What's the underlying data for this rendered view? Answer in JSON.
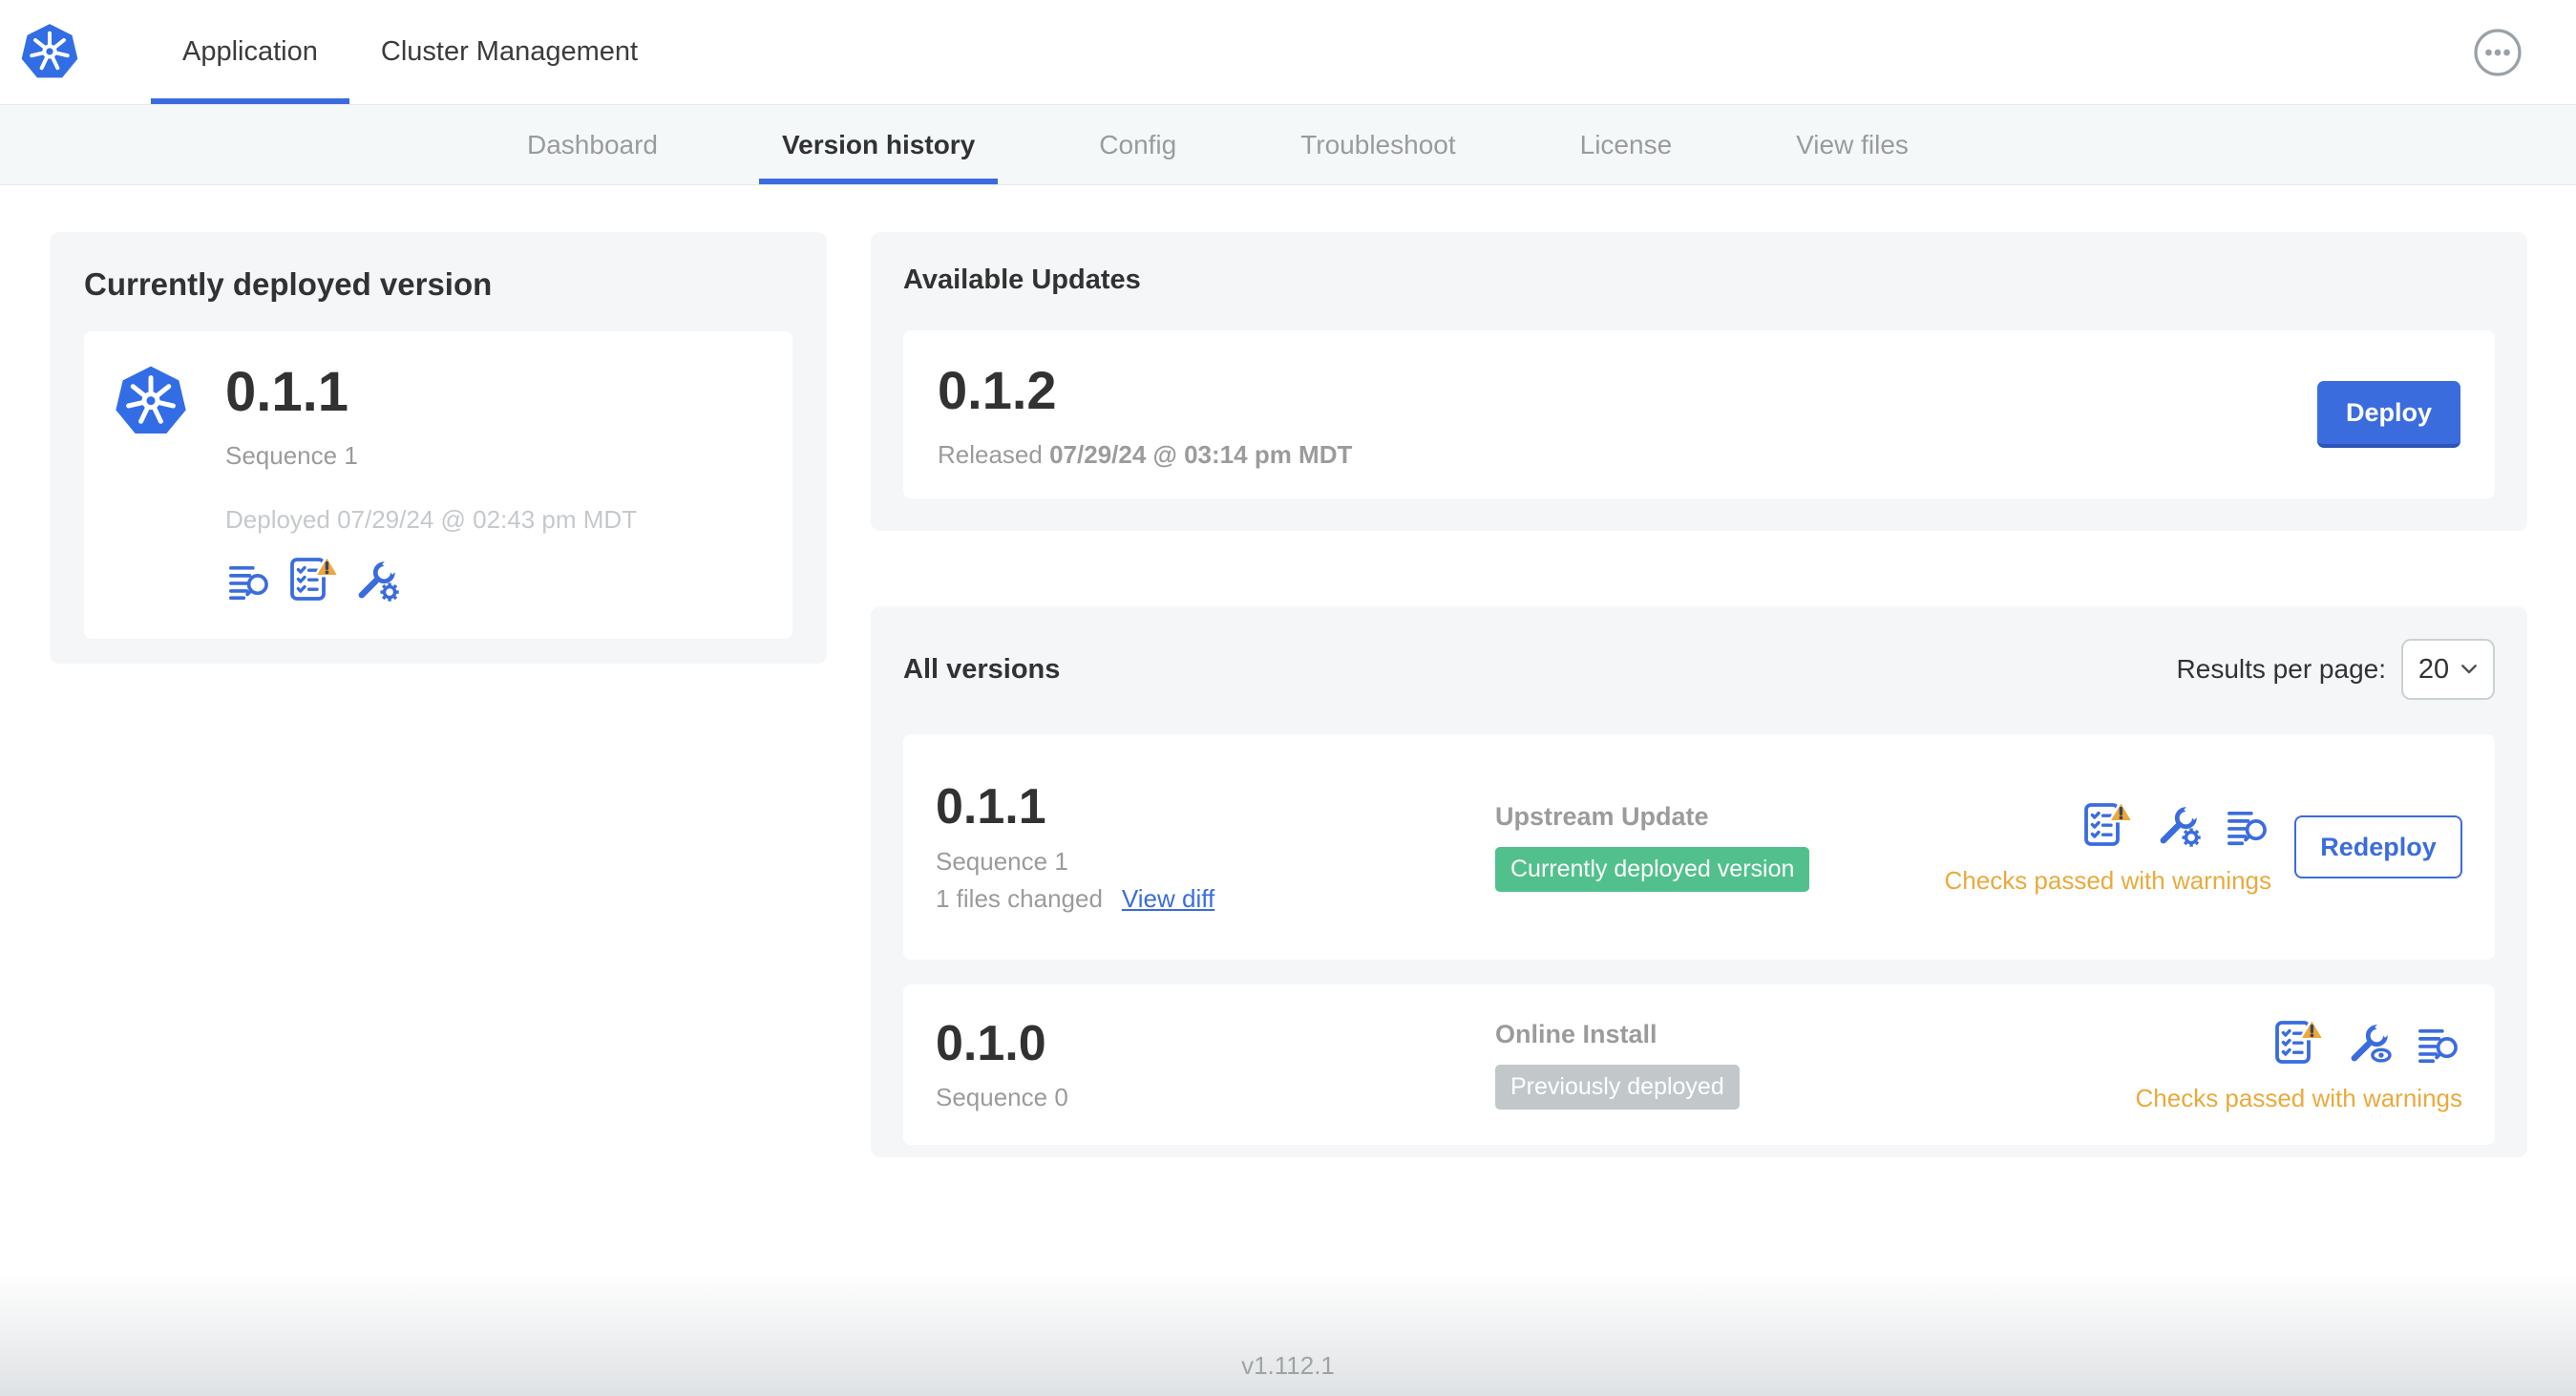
{
  "header": {
    "tabs": [
      {
        "label": "Application",
        "active": true
      },
      {
        "label": "Cluster Management",
        "active": false
      }
    ],
    "more_menu_icon": "ellipsis-in-circle"
  },
  "subnav": {
    "tabs": [
      {
        "label": "Dashboard",
        "active": false
      },
      {
        "label": "Version history",
        "active": true
      },
      {
        "label": "Config",
        "active": false
      },
      {
        "label": "Troubleshoot",
        "active": false
      },
      {
        "label": "License",
        "active": false
      },
      {
        "label": "View files",
        "active": false
      }
    ]
  },
  "current_version": {
    "title": "Currently deployed version",
    "version": "0.1.1",
    "sequence": "Sequence 1",
    "deployed": "Deployed 07/29/24 @ 02:43 pm MDT",
    "icons": [
      "release-notes-icon",
      "preflight-checks-warning-icon",
      "edit-config-icon"
    ]
  },
  "available_updates": {
    "title": "Available Updates",
    "version": "0.1.2",
    "released_prefix": "Released",
    "released_date": "07/29/24 @ 03:14 pm MDT",
    "deploy_button": "Deploy"
  },
  "all_versions": {
    "title": "All versions",
    "results_per_page_label": "Results per page:",
    "results_per_page_value": "20",
    "rows": [
      {
        "version": "0.1.1",
        "sequence": "Sequence 1",
        "files_changed": "1 files changed",
        "view_diff_link": "View diff",
        "source": "Upstream Update",
        "badge": "Currently deployed version",
        "badge_style": "green",
        "icons": [
          "preflight-checks-warning-icon",
          "edit-config-icon",
          "release-notes-icon"
        ],
        "status": "Checks passed with warnings",
        "action_button": "Redeploy"
      },
      {
        "version": "0.1.0",
        "sequence": "Sequence 0",
        "source": "Online Install",
        "badge": "Previously deployed",
        "badge_style": "gray",
        "icons": [
          "preflight-checks-warning-icon",
          "view-config-icon",
          "release-notes-icon"
        ],
        "status": "Checks passed with warnings"
      }
    ]
  },
  "footer": {
    "version": "v1.112.1"
  },
  "colors": {
    "accent_blue": "#3b6cde",
    "kubernetes_blue": "#326de6",
    "badge_green": "#52c08d",
    "badge_gray": "#c2c8ca",
    "warning_orange": "#eba93c",
    "dark_text": "#323232",
    "muted_text": "#9b9b9b"
  }
}
